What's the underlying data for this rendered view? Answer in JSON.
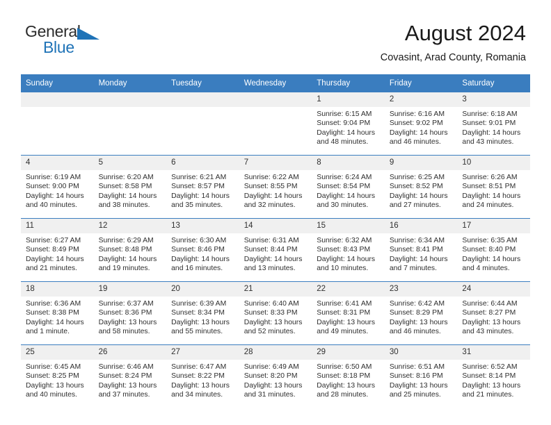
{
  "brand": {
    "word_one": "General",
    "word_two": "Blue",
    "flag_icon": "triangle-flag-icon"
  },
  "header": {
    "month_title": "August 2024",
    "location": "Covasint, Arad County, Romania"
  },
  "colors": {
    "header_blue": "#3a7dbf",
    "brand_blue": "#1f73b7",
    "daynum_gray": "#f0f0f0",
    "text": "#2e2e2e"
  },
  "calendar": {
    "weekdays": [
      "Sunday",
      "Monday",
      "Tuesday",
      "Wednesday",
      "Thursday",
      "Friday",
      "Saturday"
    ],
    "weeks": [
      [
        {
          "day": "",
          "empty": true,
          "sunrise": "",
          "sunset": "",
          "daylight_1": "",
          "daylight_2": ""
        },
        {
          "day": "",
          "empty": true,
          "sunrise": "",
          "sunset": "",
          "daylight_1": "",
          "daylight_2": ""
        },
        {
          "day": "",
          "empty": true,
          "sunrise": "",
          "sunset": "",
          "daylight_1": "",
          "daylight_2": ""
        },
        {
          "day": "",
          "empty": true,
          "sunrise": "",
          "sunset": "",
          "daylight_1": "",
          "daylight_2": ""
        },
        {
          "day": "1",
          "sunrise": "Sunrise: 6:15 AM",
          "sunset": "Sunset: 9:04 PM",
          "daylight_1": "Daylight: 14 hours",
          "daylight_2": "and 48 minutes."
        },
        {
          "day": "2",
          "sunrise": "Sunrise: 6:16 AM",
          "sunset": "Sunset: 9:02 PM",
          "daylight_1": "Daylight: 14 hours",
          "daylight_2": "and 46 minutes."
        },
        {
          "day": "3",
          "sunrise": "Sunrise: 6:18 AM",
          "sunset": "Sunset: 9:01 PM",
          "daylight_1": "Daylight: 14 hours",
          "daylight_2": "and 43 minutes."
        }
      ],
      [
        {
          "day": "4",
          "sunrise": "Sunrise: 6:19 AM",
          "sunset": "Sunset: 9:00 PM",
          "daylight_1": "Daylight: 14 hours",
          "daylight_2": "and 40 minutes."
        },
        {
          "day": "5",
          "sunrise": "Sunrise: 6:20 AM",
          "sunset": "Sunset: 8:58 PM",
          "daylight_1": "Daylight: 14 hours",
          "daylight_2": "and 38 minutes."
        },
        {
          "day": "6",
          "sunrise": "Sunrise: 6:21 AM",
          "sunset": "Sunset: 8:57 PM",
          "daylight_1": "Daylight: 14 hours",
          "daylight_2": "and 35 minutes."
        },
        {
          "day": "7",
          "sunrise": "Sunrise: 6:22 AM",
          "sunset": "Sunset: 8:55 PM",
          "daylight_1": "Daylight: 14 hours",
          "daylight_2": "and 32 minutes."
        },
        {
          "day": "8",
          "sunrise": "Sunrise: 6:24 AM",
          "sunset": "Sunset: 8:54 PM",
          "daylight_1": "Daylight: 14 hours",
          "daylight_2": "and 30 minutes."
        },
        {
          "day": "9",
          "sunrise": "Sunrise: 6:25 AM",
          "sunset": "Sunset: 8:52 PM",
          "daylight_1": "Daylight: 14 hours",
          "daylight_2": "and 27 minutes."
        },
        {
          "day": "10",
          "sunrise": "Sunrise: 6:26 AM",
          "sunset": "Sunset: 8:51 PM",
          "daylight_1": "Daylight: 14 hours",
          "daylight_2": "and 24 minutes."
        }
      ],
      [
        {
          "day": "11",
          "sunrise": "Sunrise: 6:27 AM",
          "sunset": "Sunset: 8:49 PM",
          "daylight_1": "Daylight: 14 hours",
          "daylight_2": "and 21 minutes."
        },
        {
          "day": "12",
          "sunrise": "Sunrise: 6:29 AM",
          "sunset": "Sunset: 8:48 PM",
          "daylight_1": "Daylight: 14 hours",
          "daylight_2": "and 19 minutes."
        },
        {
          "day": "13",
          "sunrise": "Sunrise: 6:30 AM",
          "sunset": "Sunset: 8:46 PM",
          "daylight_1": "Daylight: 14 hours",
          "daylight_2": "and 16 minutes."
        },
        {
          "day": "14",
          "sunrise": "Sunrise: 6:31 AM",
          "sunset": "Sunset: 8:44 PM",
          "daylight_1": "Daylight: 14 hours",
          "daylight_2": "and 13 minutes."
        },
        {
          "day": "15",
          "sunrise": "Sunrise: 6:32 AM",
          "sunset": "Sunset: 8:43 PM",
          "daylight_1": "Daylight: 14 hours",
          "daylight_2": "and 10 minutes."
        },
        {
          "day": "16",
          "sunrise": "Sunrise: 6:34 AM",
          "sunset": "Sunset: 8:41 PM",
          "daylight_1": "Daylight: 14 hours",
          "daylight_2": "and 7 minutes."
        },
        {
          "day": "17",
          "sunrise": "Sunrise: 6:35 AM",
          "sunset": "Sunset: 8:40 PM",
          "daylight_1": "Daylight: 14 hours",
          "daylight_2": "and 4 minutes."
        }
      ],
      [
        {
          "day": "18",
          "sunrise": "Sunrise: 6:36 AM",
          "sunset": "Sunset: 8:38 PM",
          "daylight_1": "Daylight: 14 hours",
          "daylight_2": "and 1 minute."
        },
        {
          "day": "19",
          "sunrise": "Sunrise: 6:37 AM",
          "sunset": "Sunset: 8:36 PM",
          "daylight_1": "Daylight: 13 hours",
          "daylight_2": "and 58 minutes."
        },
        {
          "day": "20",
          "sunrise": "Sunrise: 6:39 AM",
          "sunset": "Sunset: 8:34 PM",
          "daylight_1": "Daylight: 13 hours",
          "daylight_2": "and 55 minutes."
        },
        {
          "day": "21",
          "sunrise": "Sunrise: 6:40 AM",
          "sunset": "Sunset: 8:33 PM",
          "daylight_1": "Daylight: 13 hours",
          "daylight_2": "and 52 minutes."
        },
        {
          "day": "22",
          "sunrise": "Sunrise: 6:41 AM",
          "sunset": "Sunset: 8:31 PM",
          "daylight_1": "Daylight: 13 hours",
          "daylight_2": "and 49 minutes."
        },
        {
          "day": "23",
          "sunrise": "Sunrise: 6:42 AM",
          "sunset": "Sunset: 8:29 PM",
          "daylight_1": "Daylight: 13 hours",
          "daylight_2": "and 46 minutes."
        },
        {
          "day": "24",
          "sunrise": "Sunrise: 6:44 AM",
          "sunset": "Sunset: 8:27 PM",
          "daylight_1": "Daylight: 13 hours",
          "daylight_2": "and 43 minutes."
        }
      ],
      [
        {
          "day": "25",
          "sunrise": "Sunrise: 6:45 AM",
          "sunset": "Sunset: 8:25 PM",
          "daylight_1": "Daylight: 13 hours",
          "daylight_2": "and 40 minutes."
        },
        {
          "day": "26",
          "sunrise": "Sunrise: 6:46 AM",
          "sunset": "Sunset: 8:24 PM",
          "daylight_1": "Daylight: 13 hours",
          "daylight_2": "and 37 minutes."
        },
        {
          "day": "27",
          "sunrise": "Sunrise: 6:47 AM",
          "sunset": "Sunset: 8:22 PM",
          "daylight_1": "Daylight: 13 hours",
          "daylight_2": "and 34 minutes."
        },
        {
          "day": "28",
          "sunrise": "Sunrise: 6:49 AM",
          "sunset": "Sunset: 8:20 PM",
          "daylight_1": "Daylight: 13 hours",
          "daylight_2": "and 31 minutes."
        },
        {
          "day": "29",
          "sunrise": "Sunrise: 6:50 AM",
          "sunset": "Sunset: 8:18 PM",
          "daylight_1": "Daylight: 13 hours",
          "daylight_2": "and 28 minutes."
        },
        {
          "day": "30",
          "sunrise": "Sunrise: 6:51 AM",
          "sunset": "Sunset: 8:16 PM",
          "daylight_1": "Daylight: 13 hours",
          "daylight_2": "and 25 minutes."
        },
        {
          "day": "31",
          "sunrise": "Sunrise: 6:52 AM",
          "sunset": "Sunset: 8:14 PM",
          "daylight_1": "Daylight: 13 hours",
          "daylight_2": "and 21 minutes."
        }
      ]
    ]
  }
}
